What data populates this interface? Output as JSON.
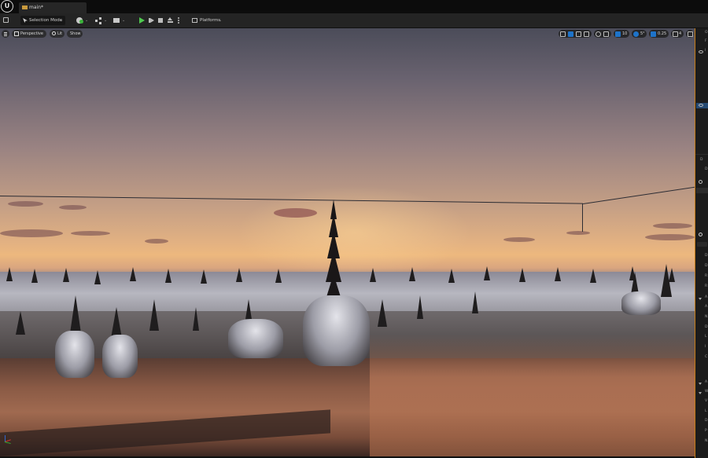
{
  "titlebar": {
    "tab_label": "main*"
  },
  "toolbar": {
    "mode_label": "Selection Mode",
    "platforms_label": "Platforms"
  },
  "viewport": {
    "perspective_label": "Perspective",
    "lit_label": "Lit",
    "show_label": "Show",
    "grid_snap_value": "10",
    "rotation_snap_value": "5°",
    "scale_snap_value": "0.25",
    "camera_speed_value": "4"
  },
  "right_panel": {
    "letters": [
      "O",
      "F",
      "I",
      "D",
      "D",
      "D",
      "D",
      "R",
      "R",
      "A",
      "A",
      "N",
      "D",
      "L",
      "I",
      "C",
      "A",
      "W",
      "V",
      "L",
      "D",
      "P",
      "N"
    ]
  },
  "colors": {
    "accent_orange": "#c47b17",
    "selection_blue": "#1e73c9",
    "play_green": "#4fc94f"
  },
  "icons": [
    "unreal-logo-icon",
    "level-icon",
    "save-icon",
    "selection-mode-icon",
    "add-actor-icon",
    "blueprint-icon",
    "cinematics-icon",
    "play-icon",
    "step-icon",
    "stop-icon",
    "eject-icon",
    "more-options-icon",
    "platforms-icon",
    "viewport-menu-icon",
    "perspective-icon",
    "lit-icon"
  ]
}
